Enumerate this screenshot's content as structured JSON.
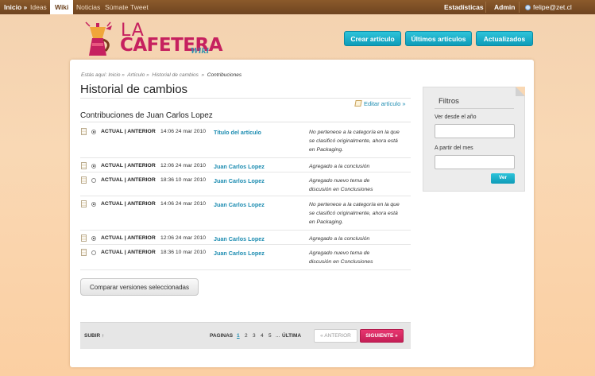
{
  "topbar": {
    "inicio": "Inicio »",
    "ideas": "Ideas",
    "wiki": "Wiki",
    "noticias": "Noticias",
    "sumate": "Súmate",
    "tweet": "Tweet",
    "estadisticas": "Estadísticas",
    "admin": "Admin",
    "user": "felipe@zet.cl"
  },
  "logo": {
    "la": "LA",
    "cafetera": "CAFETERA",
    "wiki": "Wiki"
  },
  "header_buttons": {
    "crear": "Crear artículo",
    "ultimos": "Últimos artículos",
    "actualizados": "Actualizados"
  },
  "breadcrumb": {
    "prefix": "Estás aquí: Inicio »",
    "articulo": "Artículo »",
    "historial": "Historial de cambios",
    "sep": "»",
    "current": "Contribuciones"
  },
  "page_title": "Historial de cambios",
  "edit_link": "Editar artículo »",
  "subtitle": "Contribuciones de Juan Carlos Lopez",
  "rows": [
    {
      "selected": true,
      "actions": "ACTUAL | ANTERIOR",
      "date": "14:06 24 mar 2010",
      "author": "Título del artículo",
      "comment_lines": [
        "No pertenece a la categoría en la que",
        "se clasificó originalmente, ahora está",
        "en Packaging."
      ]
    },
    {
      "selected": true,
      "actions": "ACTUAL | ANTERIOR",
      "date": "12:06 24 mar 2010",
      "author": "Juan Carlos Lopez",
      "comment_lines": [
        "Agregado a la conclusión"
      ]
    },
    {
      "selected": false,
      "actions": "ACTUAL | ANTERIOR",
      "date": "18:36 10 mar 2010",
      "author": "Juan Carlos Lopez",
      "comment_lines": [
        "Agregado nuevo tema de",
        "discusión en Conclusiones"
      ]
    },
    {
      "selected": true,
      "actions": "ACTUAL | ANTERIOR",
      "date": "14:06 24 mar 2010",
      "author": "Juan Carlos Lopez",
      "comment_lines": [
        "No pertenece a la categoría en la que",
        "se clasificó originalmente, ahora está",
        "en Packaging."
      ]
    },
    {
      "selected": true,
      "actions": "ACTUAL | ANTERIOR",
      "date": "12:06 24 mar 2010",
      "author": "Juan Carlos Lopez",
      "comment_lines": [
        "Agregado a la conclusión"
      ]
    },
    {
      "selected": false,
      "actions": "ACTUAL | ANTERIOR",
      "date": "18:36 10 mar 2010",
      "author": "Juan Carlos Lopez",
      "comment_lines": [
        "Agregado nuevo tema de",
        "discusión en Conclusiones"
      ]
    }
  ],
  "compare_button": "Comparar versiones seleccionadas",
  "pager": {
    "subir": "SUBIR ↑",
    "paginas": "PAGINAS",
    "pages": [
      "1",
      "2",
      "3",
      "4",
      "5"
    ],
    "ellipsis": "...",
    "ultima": "ÚLTIMA",
    "anterior": "« ANTERIOR",
    "siguiente": "SIGUIENTE »"
  },
  "filters": {
    "title": "Filtros",
    "year_label": "Ver desde el año",
    "year_value": "",
    "month_label": "A partir del mes",
    "month_value": "",
    "submit": "Ver"
  },
  "colors": {
    "brand_pink": "#c6215f",
    "accent_cyan": "#1aafc9",
    "link_blue": "#1a8bb0",
    "topbar_brown": "#7a4d25"
  }
}
